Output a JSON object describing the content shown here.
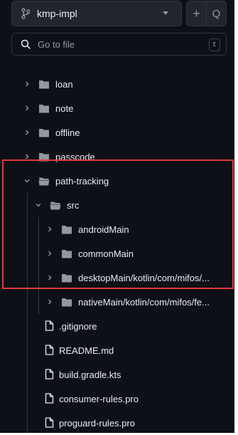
{
  "header": {
    "branch_name": "kmp-impl",
    "add_label": "+",
    "search_label": "Q"
  },
  "search": {
    "placeholder": "Go to file",
    "shortcut": "t"
  },
  "tree": {
    "items": [
      {
        "label": "loan",
        "kind": "folder",
        "state": "collapsed"
      },
      {
        "label": "note",
        "kind": "folder",
        "state": "collapsed"
      },
      {
        "label": "offline",
        "kind": "folder",
        "state": "collapsed"
      },
      {
        "label": "passcode",
        "kind": "folder",
        "state": "collapsed"
      },
      {
        "label": "path-tracking",
        "kind": "folder",
        "state": "expanded"
      },
      {
        "label": "src",
        "kind": "folder",
        "state": "expanded"
      },
      {
        "label": "androidMain",
        "kind": "folder",
        "state": "collapsed"
      },
      {
        "label": "commonMain",
        "kind": "folder",
        "state": "collapsed"
      },
      {
        "label": "desktopMain/kotlin/com/mifos/...",
        "kind": "folder",
        "state": "collapsed"
      },
      {
        "label": "nativeMain/kotlin/com/mifos/fe...",
        "kind": "folder",
        "state": "collapsed"
      },
      {
        "label": ".gitignore",
        "kind": "file"
      },
      {
        "label": "README.md",
        "kind": "file"
      },
      {
        "label": "build.gradle.kts",
        "kind": "file"
      },
      {
        "label": "consumer-rules.pro",
        "kind": "file"
      },
      {
        "label": "proguard-rules.pro",
        "kind": "file"
      }
    ]
  },
  "colors": {
    "background": "#0d1117",
    "text": "#e6edf3",
    "muted": "#9198a1",
    "folder": "#9198a1",
    "highlight_border": "#e5383b"
  }
}
